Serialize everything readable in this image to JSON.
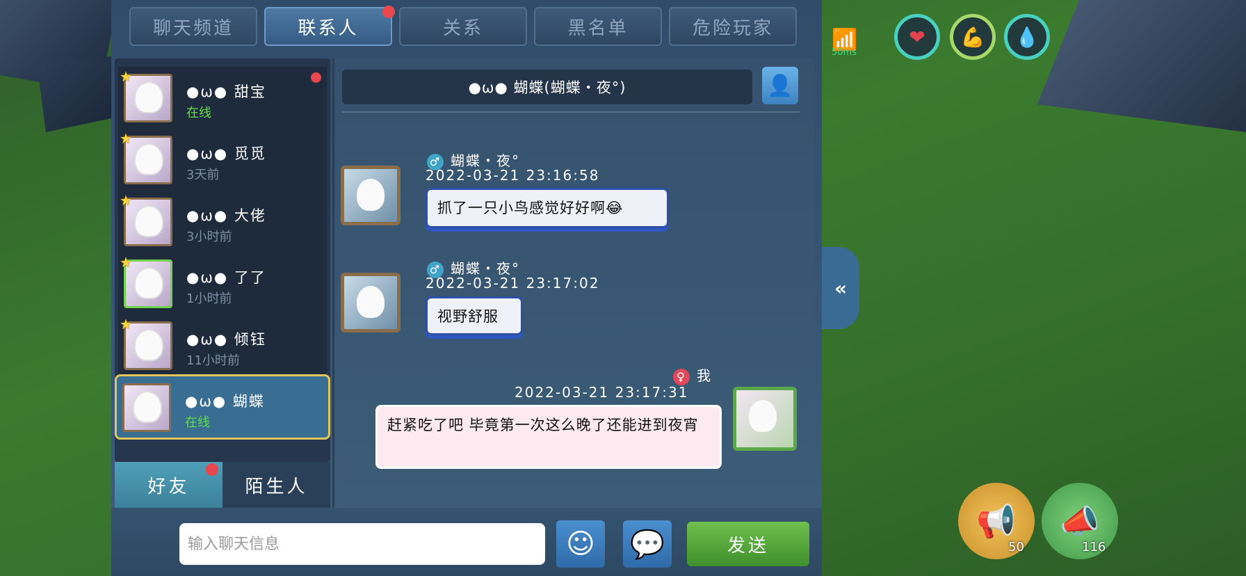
{
  "tabs": [
    {
      "label": "聊天频道",
      "active": false,
      "badge": false
    },
    {
      "label": "联系人",
      "active": true,
      "badge": true
    },
    {
      "label": "关系",
      "active": false,
      "badge": false
    },
    {
      "label": "黑名单",
      "active": false,
      "badge": false
    },
    {
      "label": "危险玩家",
      "active": false,
      "badge": false
    }
  ],
  "contacts": [
    {
      "name": "●ω● 甜宝",
      "status": "在线",
      "online": true,
      "badge": true
    },
    {
      "name": "●ω● 觅觅",
      "status": "3天前",
      "online": false,
      "badge": false
    },
    {
      "name": "●ω● 大佬",
      "status": "3小时前",
      "online": false,
      "badge": false
    },
    {
      "name": "●ω● 了了",
      "status": "1小时前",
      "online": false,
      "badge": false
    },
    {
      "name": "●ω● 倾钰",
      "status": "11小时前",
      "online": false,
      "badge": false
    },
    {
      "name": "●ω● 蝴蝶",
      "status": "在线",
      "online": true,
      "badge": false
    }
  ],
  "bottom_tabs": {
    "friends": "好友",
    "strangers": "陌生人"
  },
  "chat": {
    "header": "●ω● 蝴蝶(蝴蝶・夜°)",
    "messages": [
      {
        "sender": "蝴蝶・夜°",
        "gender": "♂",
        "time": "2022-03-21   23:16:58",
        "text": "抓了一只小鸟感觉好好啊😂"
      },
      {
        "sender": "蝴蝶・夜°",
        "gender": "♂",
        "time": "2022-03-21   23:17:02",
        "text": "视野舒服"
      },
      {
        "sender": "我",
        "gender": "♀",
        "time": "2022-03-21   23:17:31",
        "text": "赶紧吃了吧 毕竟第一次这么晚了还能进到夜宵"
      }
    ]
  },
  "input": {
    "placeholder": "输入聊天信息",
    "send_label": "发送"
  },
  "hud": {
    "ping": "50ms",
    "megaphone_gold_count": "50",
    "megaphone_green_count": "116"
  },
  "icons": {
    "heart": "heart-icon",
    "stamina": "arm-icon",
    "water": "water-drop-icon",
    "wifi": "wifi-icon",
    "profile": "person-icon",
    "emoji": "smile-icon",
    "bubble": "speech-bubble-icon",
    "collapse": "double-chevron-left-icon"
  }
}
